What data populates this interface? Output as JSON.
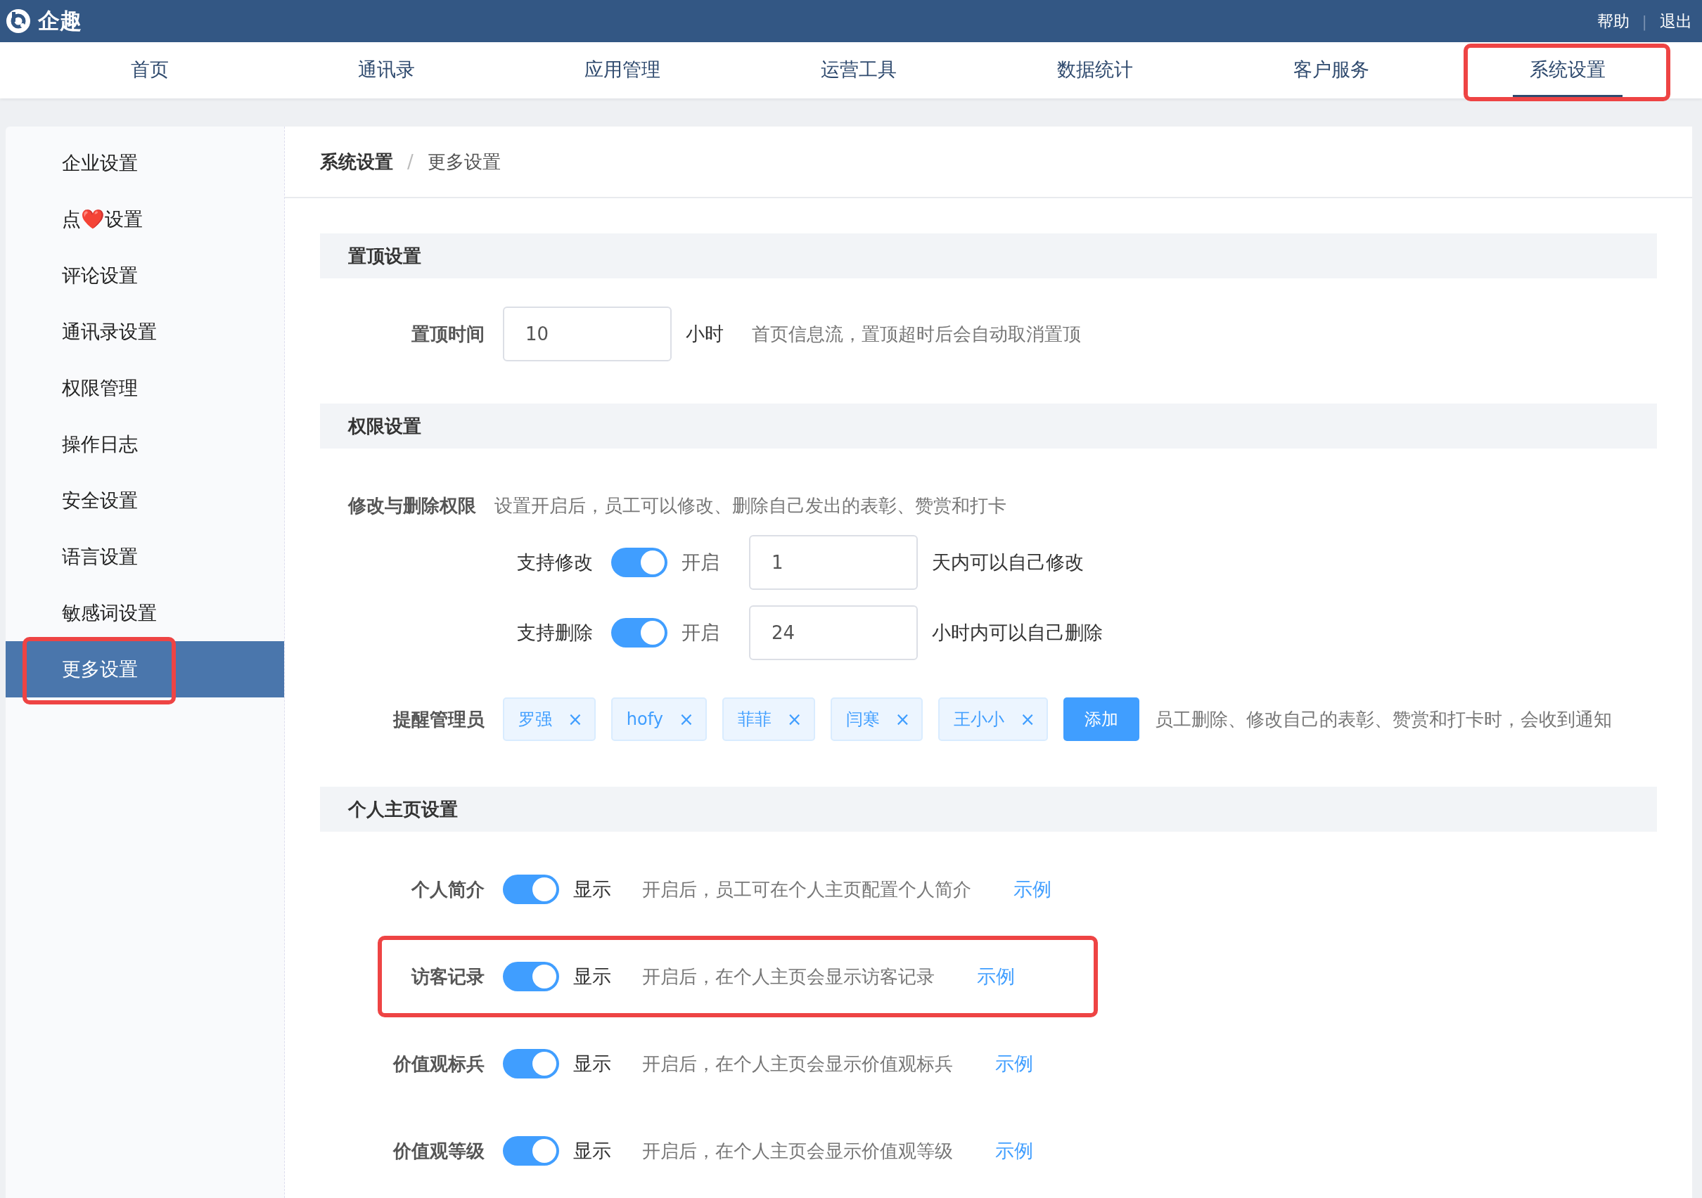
{
  "header": {
    "logo": "企趣",
    "links": [
      "帮助",
      "退出"
    ],
    "divider": "|"
  },
  "nav": [
    {
      "label": "首页",
      "selected": false,
      "highlighted": false
    },
    {
      "label": "通讯录",
      "selected": false,
      "highlighted": false
    },
    {
      "label": "应用管理",
      "selected": false,
      "highlighted": false
    },
    {
      "label": "运营工具",
      "selected": false,
      "highlighted": false
    },
    {
      "label": "数据统计",
      "selected": false,
      "highlighted": false
    },
    {
      "label": "客户服务",
      "selected": false,
      "highlighted": false
    },
    {
      "label": "系统设置",
      "selected": true,
      "highlighted": true
    }
  ],
  "sidebar": [
    {
      "label": "企业设置",
      "selected": false,
      "highlighted": false
    },
    {
      "label": "点❤️设置",
      "selected": false,
      "highlighted": false
    },
    {
      "label": "评论设置",
      "selected": false,
      "highlighted": false
    },
    {
      "label": "通讯录设置",
      "selected": false,
      "highlighted": false
    },
    {
      "label": "权限管理",
      "selected": false,
      "highlighted": false
    },
    {
      "label": "操作日志",
      "selected": false,
      "highlighted": false
    },
    {
      "label": "安全设置",
      "selected": false,
      "highlighted": false
    },
    {
      "label": "语言设置",
      "selected": false,
      "highlighted": false
    },
    {
      "label": "敏感词设置",
      "selected": false,
      "highlighted": false
    },
    {
      "label": "更多设置",
      "selected": true,
      "highlighted": true
    }
  ],
  "breadcrumb": {
    "items": [
      "系统设置",
      "更多设置"
    ],
    "separator": "/"
  },
  "pin_section": {
    "title": "置顶设置",
    "label": "置顶时间",
    "value": "10",
    "unit": "小时",
    "hint": "首页信息流，置顶超时后会自动取消置顶"
  },
  "permission_section": {
    "title": "权限设置",
    "edit_rights": {
      "label": "修改与删除权限",
      "hint": "设置开启后，员工可以修改、删除自己发出的表彰、赞赏和打卡",
      "rows": [
        {
          "label": "支持修改",
          "on": true,
          "state_text": "开启",
          "value": "1",
          "suffix": "天内可以自己修改"
        },
        {
          "label": "支持删除",
          "on": true,
          "state_text": "开启",
          "value": "24",
          "suffix": "小时内可以自己删除"
        }
      ]
    },
    "admins": {
      "label": "提醒管理员",
      "tags": [
        "罗强",
        "hofy",
        "菲菲",
        "闫寒",
        "王小小"
      ],
      "remove_icon": "×",
      "add_button": "添加",
      "hint": "员工删除、修改自己的表彰、赞赏和打卡时，会收到通知"
    }
  },
  "profile_section": {
    "title": "个人主页设置",
    "rows": [
      {
        "label": "个人简介",
        "on": true,
        "state_text": "显示",
        "hint": "开启后，员工可在个人主页配置个人简介",
        "link": "示例",
        "highlighted": false
      },
      {
        "label": "访客记录",
        "on": true,
        "state_text": "显示",
        "hint": "开启后，在个人主页会显示访客记录",
        "link": "示例",
        "highlighted": true
      },
      {
        "label": "价值观标兵",
        "on": true,
        "state_text": "显示",
        "hint": "开启后，在个人主页会显示价值观标兵",
        "link": "示例",
        "highlighted": false
      },
      {
        "label": "价值观等级",
        "on": true,
        "state_text": "显示",
        "hint": "开启后，在个人主页会显示价值观等级",
        "link": "示例",
        "highlighted": false
      }
    ]
  }
}
